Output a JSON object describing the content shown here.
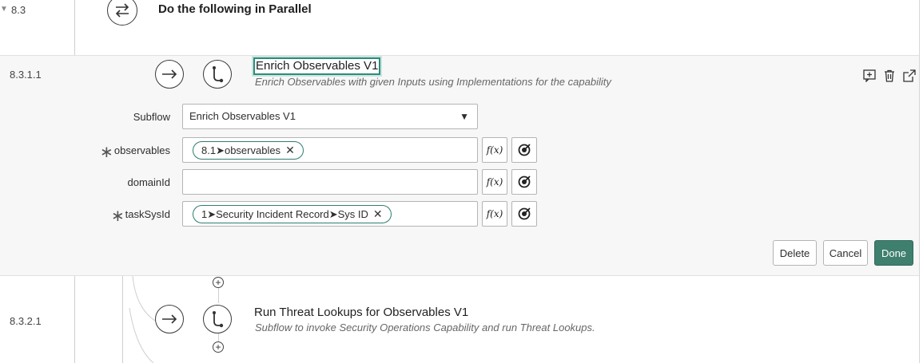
{
  "parallel_step": {
    "number": "8.3",
    "title": "Do the following in Parallel",
    "icon": "parallel-arrows-icon"
  },
  "active_step": {
    "number": "8.3.1.1",
    "title": "Enrich Observables V1",
    "description": "Enrich Observables with given Inputs using Implementations for the capability",
    "actions": [
      "add-comment-icon",
      "trash-icon",
      "open-external-icon"
    ],
    "form": {
      "subflow": {
        "label": "Subflow",
        "value": "Enrich Observables V1"
      },
      "inputs": [
        {
          "label": "observables",
          "required": true,
          "pill": "8.1➤observables"
        },
        {
          "label": "domainId",
          "required": false,
          "pill": ""
        },
        {
          "label": "taskSysId",
          "required": true,
          "pill": "1➤Security Incident Record➤Sys ID"
        }
      ],
      "fx_label": "f(x)"
    },
    "buttons": {
      "delete": "Delete",
      "cancel": "Cancel",
      "done": "Done"
    }
  },
  "next_step": {
    "number": "8.3.2.1",
    "title": "Run Threat Lookups for Observables V1",
    "description": "Subflow to invoke Security Operations Capability and run Threat Lookups."
  },
  "colors": {
    "accent": "#3f7f6e",
    "pill_border": "#2e7d6e",
    "panel_bg": "#f7f7f7"
  }
}
